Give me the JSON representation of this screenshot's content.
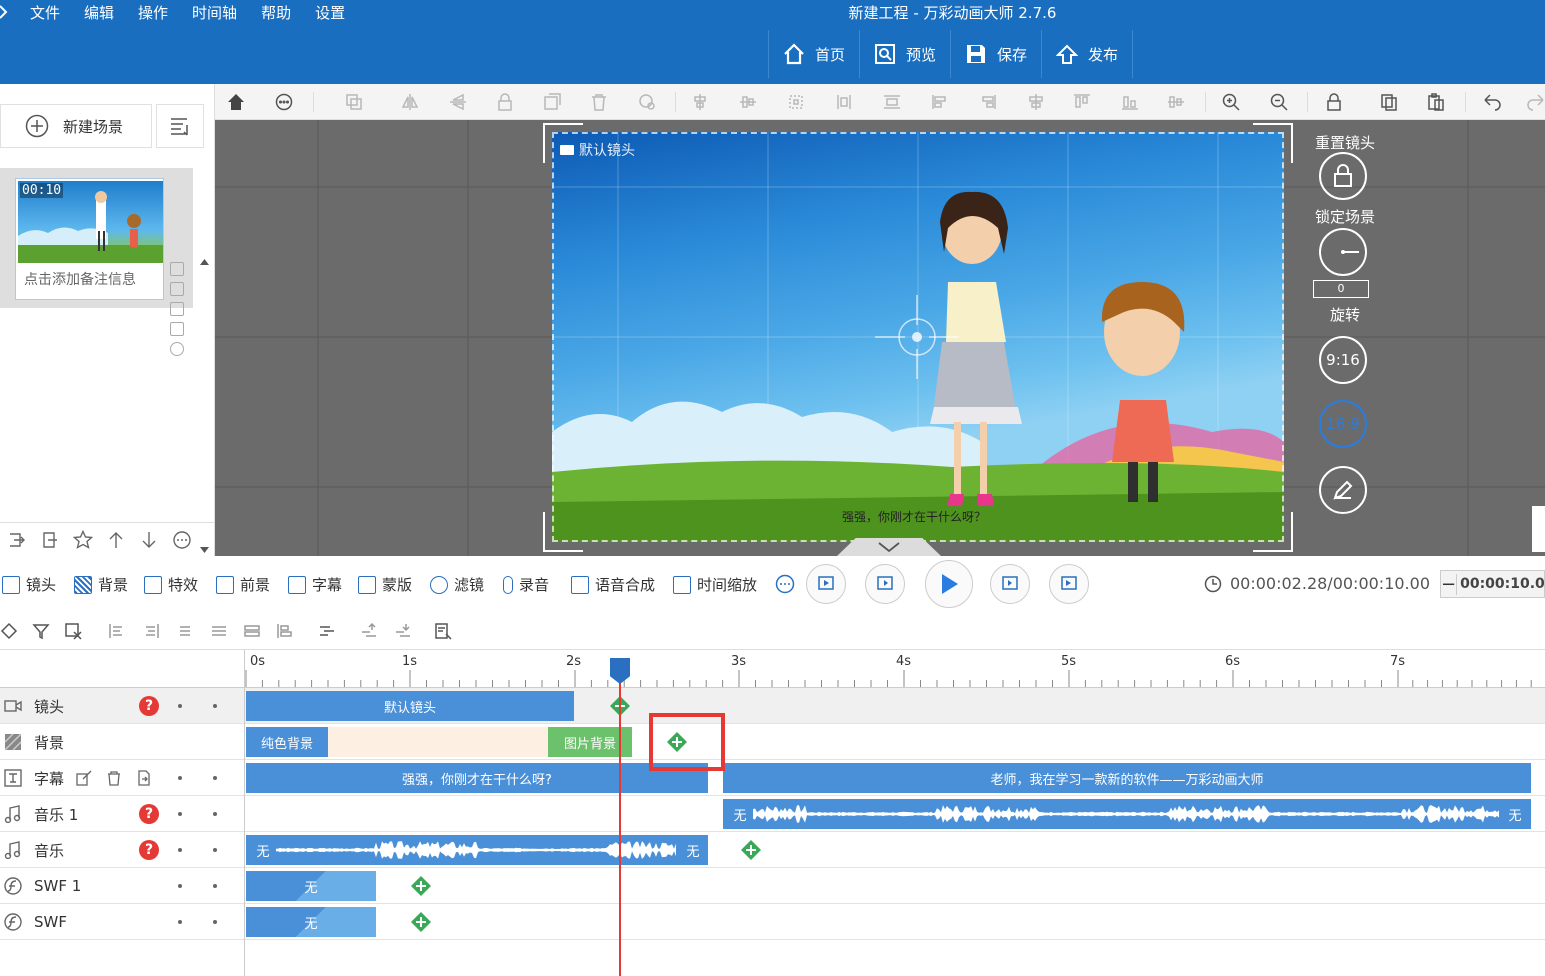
{
  "menu": [
    "文件",
    "编辑",
    "操作",
    "时间轴",
    "帮助",
    "设置"
  ],
  "app_title": "新建工程 - 万彩动画大师 2.7.6",
  "top_buttons": [
    {
      "label": "首页",
      "icon": "home-icon"
    },
    {
      "label": "预览",
      "icon": "preview-icon"
    },
    {
      "label": "保存",
      "icon": "save-icon"
    },
    {
      "label": "发布",
      "icon": "publish-icon"
    }
  ],
  "left": {
    "new_scene": "新建场景",
    "scene_time": "00:10",
    "scene_note": "点击添加备注信息"
  },
  "canvas": {
    "camera_label": "默认镜头",
    "subtitle_line": "强强，你刚才在干什么呀？"
  },
  "right_controls": {
    "reset_camera": "重置镜头",
    "lock_scene": "锁定场景",
    "rotation_value": "0",
    "rotate": "旋转",
    "ratio_916": "9:16",
    "ratio_169": "16:9"
  },
  "layers": [
    {
      "label": "镜头",
      "icon": "camera-icon"
    },
    {
      "label": "背景",
      "icon": "background-icon"
    },
    {
      "label": "特效",
      "icon": "effects-icon"
    },
    {
      "label": "前景",
      "icon": "foreground-icon"
    },
    {
      "label": "字幕",
      "icon": "subtitle-icon"
    },
    {
      "label": "蒙版",
      "icon": "mask-icon"
    },
    {
      "label": "滤镜",
      "icon": "filter-icon"
    },
    {
      "label": "录音",
      "icon": "record-icon"
    },
    {
      "label": "语音合成",
      "icon": "tts-icon"
    },
    {
      "label": "时间缩放",
      "icon": "time-scale-icon"
    }
  ],
  "time_display": "00:00:02.28/00:00:10.00",
  "zoom_value": "00:00:10.0",
  "ruler": [
    "0s",
    "1s",
    "2s",
    "3s",
    "4s",
    "5s",
    "6s",
    "7s"
  ],
  "tracks": [
    {
      "name": "镜头",
      "clips": [
        {
          "label": "默认镜头"
        }
      ]
    },
    {
      "name": "背景",
      "clips": [
        {
          "label": "纯色背景"
        },
        {
          "label": "图片背景"
        }
      ]
    },
    {
      "name": "字幕",
      "clips": [
        {
          "label": "强强，你刚才在干什么呀?"
        },
        {
          "label": "老师，我在学习一款新的软件——万彩动画大师"
        }
      ]
    },
    {
      "name": "音乐 1",
      "clips": [
        {
          "label": "无"
        },
        {
          "label": "无"
        }
      ]
    },
    {
      "name": "音乐",
      "clips": [
        {
          "label": "无"
        },
        {
          "label": "无"
        }
      ]
    },
    {
      "name": "SWF 1",
      "clips": [
        {
          "label": "无"
        }
      ]
    },
    {
      "name": "SWF",
      "clips": [
        {
          "label": "无"
        }
      ]
    }
  ],
  "colors": {
    "title_bar": "#1a6ec0",
    "clip_blue": "#4a90d9",
    "clip_green": "#6cc26c",
    "playhead": "#e53935",
    "keyframe": "#3aa857"
  }
}
